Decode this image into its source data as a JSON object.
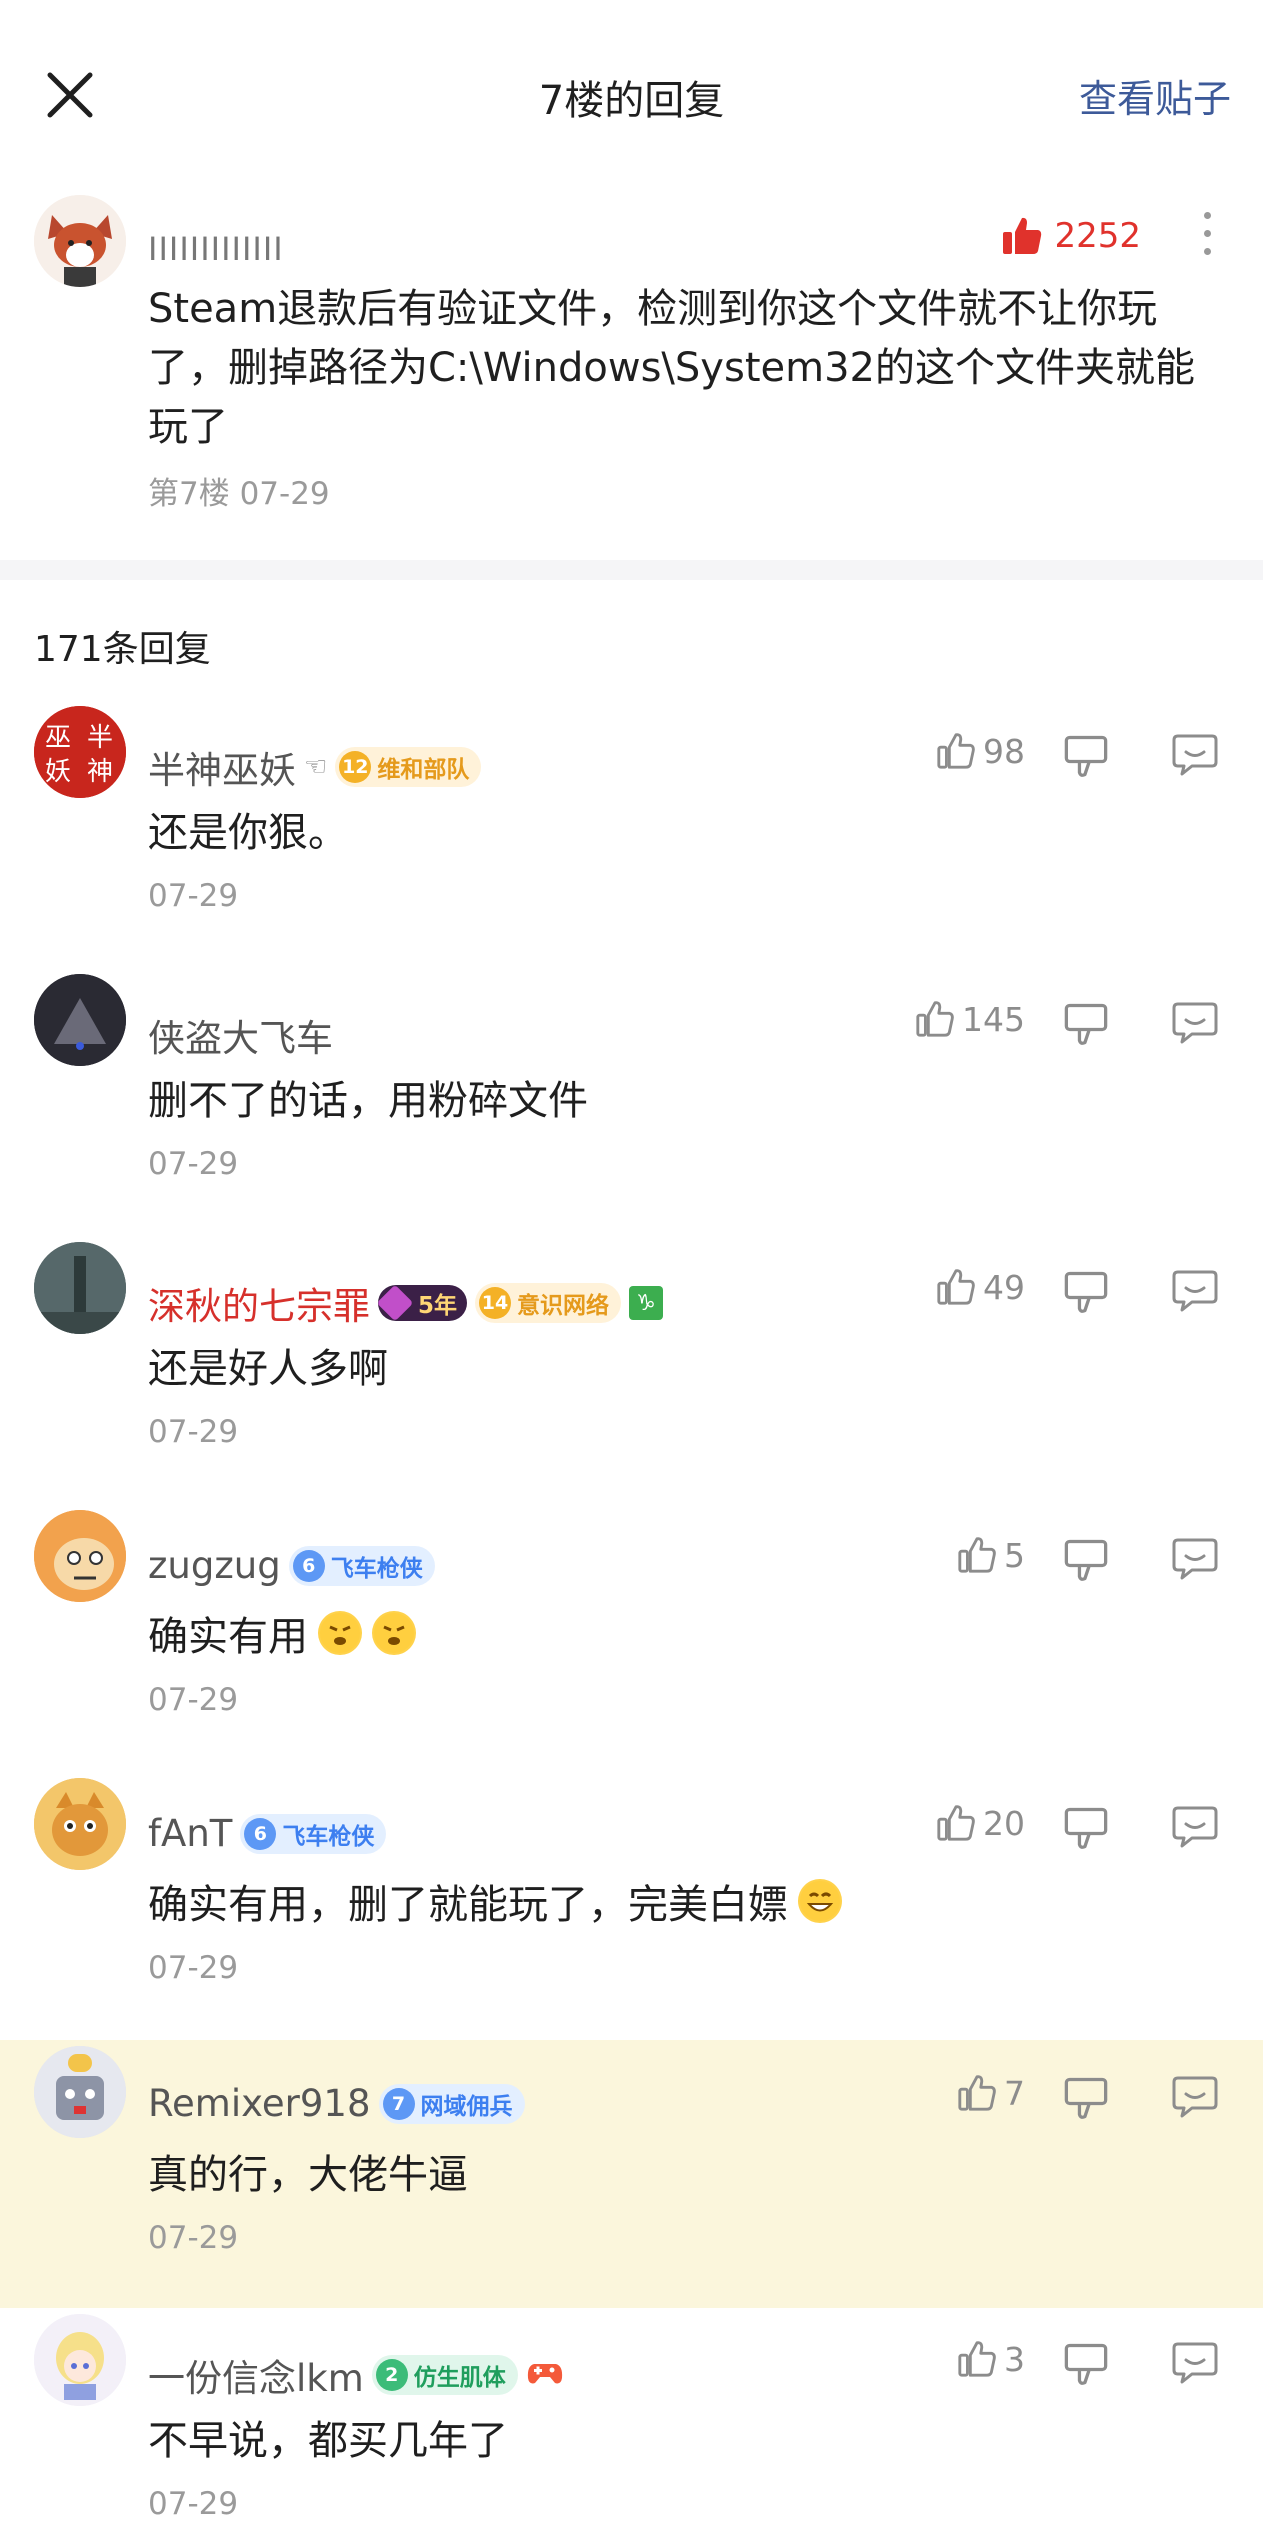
{
  "topbar": {
    "title": "7楼的回复",
    "view_post": "查看贴子"
  },
  "main_post": {
    "username": "IIIIIIIIIIIII",
    "likes": "2252",
    "text": "Steam退款后有验证文件，检测到你这个文件就不让你玩了，删掉路径为C:\\Windows\\System32的这个文件夹就能玩了",
    "meta": "第7楼 07-29"
  },
  "reply_count": "171条回复",
  "replies": [
    {
      "name": "半神巫妖",
      "avatar_text": "巫半\n妖神",
      "badge": {
        "level": "12",
        "text": "维和部队",
        "color": "gold"
      },
      "text": "还是你狠。",
      "date": "07-29",
      "likes": "98"
    },
    {
      "name": "侠盗大飞车",
      "text": "删不了的话，用粉碎文件",
      "date": "07-29",
      "likes": "145"
    },
    {
      "name": "深秋的七宗罪",
      "year_badge": "5年",
      "badge": {
        "level": "14",
        "text": "意识网络",
        "color": "gold"
      },
      "zodiac": "♑",
      "text": "还是好人多啊",
      "date": "07-29",
      "likes": "49"
    },
    {
      "name": "zugzug",
      "badge": {
        "level": "6",
        "text": "飞车枪侠",
        "color": "blue"
      },
      "text": "确实有用",
      "date": "07-29",
      "likes": "5"
    },
    {
      "name": "fAnT",
      "badge": {
        "level": "6",
        "text": "飞车枪侠",
        "color": "blue"
      },
      "text": "确实有用，删了就能玩了，完美白嫖",
      "date": "07-29",
      "likes": "20"
    },
    {
      "name": "Remixer918",
      "badge": {
        "level": "7",
        "text": "网域佣兵",
        "color": "blue"
      },
      "text": "真的行，大佬牛逼",
      "date": "07-29",
      "likes": "7"
    },
    {
      "name": "一份信念lkm",
      "badge": {
        "level": "2",
        "text": "仿生肌体",
        "color": "green"
      },
      "text": "不早说，都买几年了",
      "date": "07-29",
      "likes": "3"
    }
  ],
  "colors": {
    "accent_blue": "#3d5a99",
    "like_red": "#e0322c",
    "highlight_bg": "#fbf6dc"
  }
}
